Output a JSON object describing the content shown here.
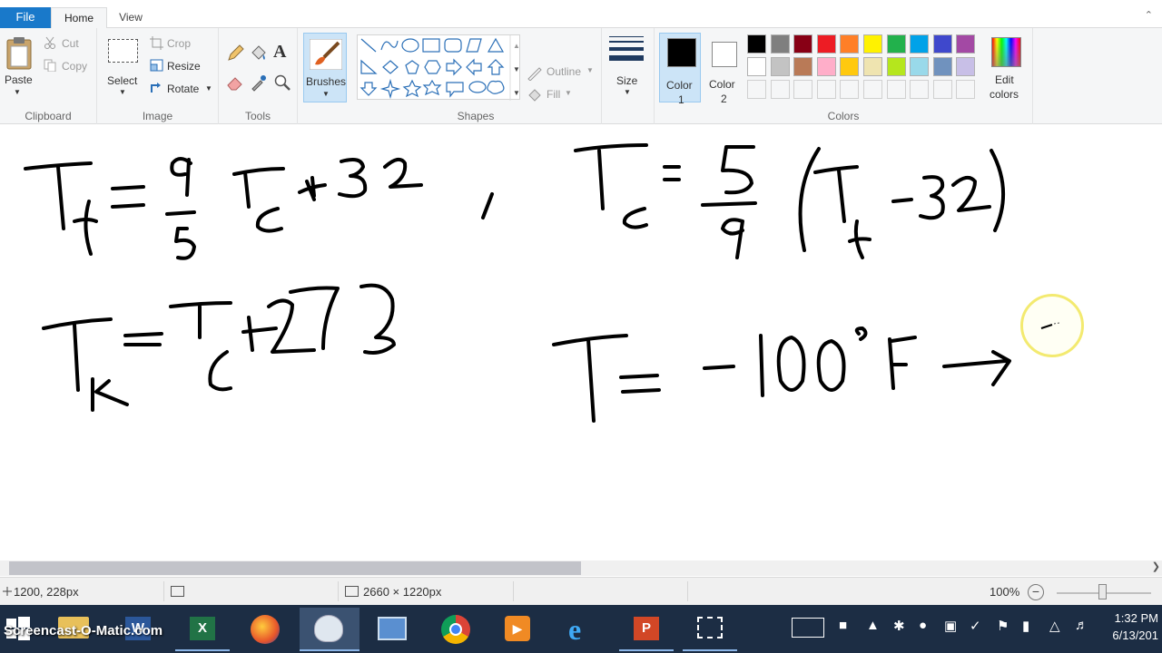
{
  "tabs": {
    "file": "File",
    "home": "Home",
    "view": "View"
  },
  "clipboard": {
    "paste": "Paste",
    "cut": "Cut",
    "copy": "Copy",
    "group": "Clipboard"
  },
  "image": {
    "select": "Select",
    "crop": "Crop",
    "resize": "Resize",
    "rotate": "Rotate",
    "group": "Image"
  },
  "tools": {
    "group": "Tools"
  },
  "brushes": {
    "label": "Brushes"
  },
  "shapes": {
    "outline": "Outline",
    "fill": "Fill",
    "group": "Shapes"
  },
  "size": {
    "label": "Size"
  },
  "colors": {
    "color1_label": "Color",
    "color1_num": "1",
    "color2_label": "Color",
    "color2_num": "2",
    "edit_colors": "Edit",
    "edit_colors2": "colors",
    "group": "Colors",
    "color1": "#000000",
    "color2": "#ffffff",
    "palette_row1": [
      "#000000",
      "#7f7f7f",
      "#880015",
      "#ed1c24",
      "#ff7f27",
      "#fff200",
      "#22b14c",
      "#00a2e8",
      "#3f48cc",
      "#a349a4"
    ],
    "palette_row2": [
      "#ffffff",
      "#c3c3c3",
      "#b97a57",
      "#ffaec9",
      "#ffc90e",
      "#efe4b0",
      "#b5e61d",
      "#99d9ea",
      "#7092be",
      "#c8bfe7"
    ]
  },
  "status": {
    "cursor_pos": "1200, 228px",
    "image_size": "2660 × 1220px",
    "zoom": "100%"
  },
  "taskbar": {
    "watermark": "Screencast-O-Matic.com",
    "time": "1:32 PM",
    "date": "6/13/201"
  }
}
